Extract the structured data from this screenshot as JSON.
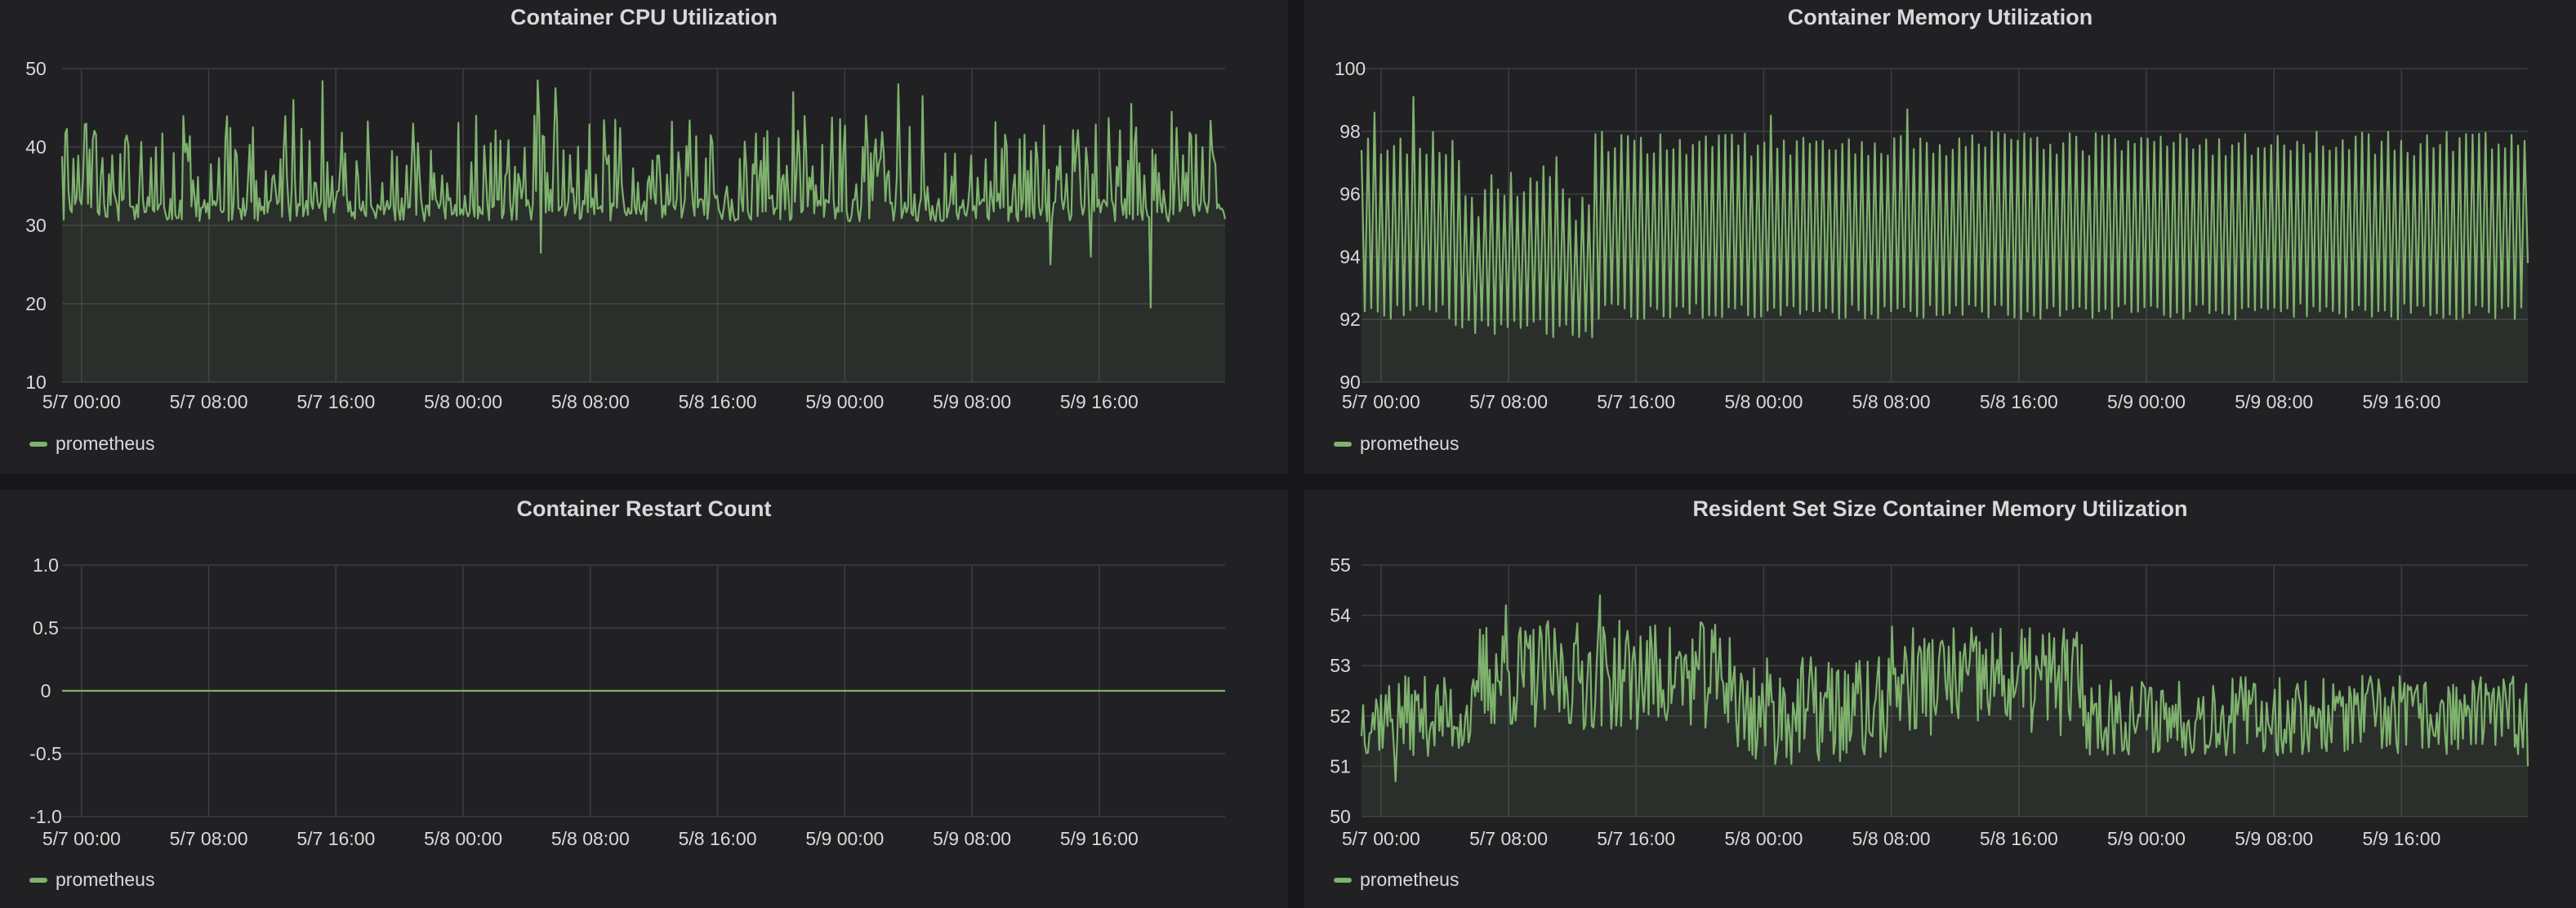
{
  "colors": {
    "background": "#161719",
    "panel": "#212124",
    "series": "#7eb26d",
    "fill": "#2e302c",
    "grid": "#3d3e41",
    "text": "#d8d9da"
  },
  "panels": [
    {
      "title": "Container CPU Utilization",
      "legend": "prometheus"
    },
    {
      "title": "Container Memory Utilization",
      "legend": "prometheus"
    },
    {
      "title": "Container Restart Count",
      "legend": "prometheus"
    },
    {
      "title": "Resident Set Size Container Memory Utilization",
      "legend": "prometheus"
    }
  ],
  "chart_data": [
    {
      "type": "area",
      "title": "Container CPU Utilization",
      "ylim": [
        10,
        50
      ],
      "ytick_labels": [
        "10",
        "20",
        "30",
        "40",
        "50"
      ],
      "x_start": "5/7 00:00",
      "x_end": "5/9 24:00",
      "xtick_labels": [
        "5/7 00:00",
        "5/7 08:00",
        "5/7 16:00",
        "5/8 00:00",
        "5/8 08:00",
        "5/8 16:00",
        "5/9 00:00",
        "5/9 08:00",
        "5/9 16:00"
      ],
      "grid": true,
      "legend_position": "bottom-left",
      "series": [
        {
          "name": "prometheus",
          "baseline": 31,
          "typical_peak_range": [
            38,
            44
          ],
          "max": 48.5,
          "min": 19.5,
          "points_estimated": [
            [
              "5/7 00:00",
              38
            ],
            [
              "5/7 01:00",
              41
            ],
            [
              "5/7 02:00",
              36
            ],
            [
              "5/7 03:00",
              32
            ],
            [
              "5/7 04:00",
              40
            ],
            [
              "5/7 05:00",
              34
            ],
            [
              "5/7 08:00",
              36
            ],
            [
              "5/7 11:00",
              46
            ],
            [
              "5/7 13:00",
              44
            ],
            [
              "5/7 15:00",
              48.5
            ],
            [
              "5/7 17:00",
              33
            ],
            [
              "5/7 20:00",
              43
            ],
            [
              "5/8 00:00",
              44
            ],
            [
              "5/8 03:00",
              41
            ],
            [
              "5/8 05:00",
              48.5
            ],
            [
              "5/8 06:00",
              27
            ],
            [
              "5/8 08:00",
              42
            ],
            [
              "5/8 12:00",
              44
            ],
            [
              "5/8 16:00",
              43
            ],
            [
              "5/8 20:00",
              46
            ],
            [
              "5/9 00:00",
              45
            ],
            [
              "5/9 04:00",
              48
            ],
            [
              "5/9 08:00",
              43
            ],
            [
              "5/9 12:00",
              45
            ],
            [
              "5/9 14:00",
              25
            ],
            [
              "5/9 16:00",
              26
            ],
            [
              "5/9 17:00",
              19.5
            ],
            [
              "5/9 20:00",
              44
            ],
            [
              "5/9 22:00",
              42
            ],
            [
              "5/9 24:00",
              31
            ]
          ]
        }
      ]
    },
    {
      "type": "area",
      "title": "Container Memory Utilization",
      "ylim": [
        90,
        100
      ],
      "ytick_labels": [
        "90",
        "92",
        "94",
        "96",
        "98",
        "100"
      ],
      "x_start": "5/7 00:00",
      "x_end": "5/9 24:00",
      "xtick_labels": [
        "5/7 00:00",
        "5/7 08:00",
        "5/7 16:00",
        "5/8 00:00",
        "5/8 08:00",
        "5/8 16:00",
        "5/9 00:00",
        "5/9 08:00",
        "5/9 16:00"
      ],
      "grid": true,
      "legend_position": "bottom-left",
      "series": [
        {
          "name": "prometheus",
          "oscillation_range": [
            92,
            97.8
          ],
          "max": 99.1,
          "min": 91.4,
          "points_estimated": [
            [
              "5/7 00:00",
              96.5
            ],
            [
              "5/7 02:00",
              98.6
            ],
            [
              "5/7 06:00",
              99.1
            ],
            [
              "5/7 07:00",
              91.4
            ],
            [
              "5/7 08:00",
              91.5
            ],
            [
              "5/7 16:00",
              97.8
            ],
            [
              "5/8 00:00",
              97.3
            ],
            [
              "5/8 06:00",
              98.5
            ],
            [
              "5/8 08:00",
              98.7
            ],
            [
              "5/8 14:00",
              98.8
            ],
            [
              "5/9 00:00",
              97.7
            ],
            [
              "5/9 08:00",
              97.8
            ],
            [
              "5/9 12:00",
              98.1
            ],
            [
              "5/9 24:00",
              93.8
            ]
          ]
        }
      ]
    },
    {
      "type": "area",
      "title": "Container Restart Count",
      "ylim": [
        -1.0,
        1.0
      ],
      "ytick_labels": [
        "1.0",
        "0.5",
        "0",
        "-0.5",
        "-1.0"
      ],
      "x_start": "5/7 00:00",
      "x_end": "5/9 24:00",
      "xtick_labels": [
        "5/7 00:00",
        "5/7 08:00",
        "5/7 16:00",
        "5/8 00:00",
        "5/8 08:00",
        "5/8 16:00",
        "5/9 00:00",
        "5/9 08:00",
        "5/9 16:00"
      ],
      "grid": true,
      "legend_position": "bottom-left",
      "series": [
        {
          "name": "prometheus",
          "points": [
            [
              "5/7 00:00",
              0
            ],
            [
              "5/9 24:00",
              0
            ]
          ]
        }
      ]
    },
    {
      "type": "area",
      "title": "Resident Set Size Container Memory Utilization",
      "ylim": [
        50,
        55
      ],
      "ytick_labels": [
        "50",
        "51",
        "52",
        "53",
        "54",
        "55"
      ],
      "x_start": "5/7 00:00",
      "x_end": "5/9 24:00",
      "xtick_labels": [
        "5/7 00:00",
        "5/7 08:00",
        "5/7 16:00",
        "5/8 00:00",
        "5/8 08:00",
        "5/8 16:00",
        "5/9 00:00",
        "5/9 08:00",
        "5/9 16:00"
      ],
      "grid": true,
      "legend_position": "bottom-left",
      "series": [
        {
          "name": "prometheus",
          "max": 54.4,
          "min": 50.6,
          "points_estimated": [
            [
              "5/7 00:00",
              51.5
            ],
            [
              "5/7 02:00",
              51.0
            ],
            [
              "5/7 03:00",
              50.6
            ],
            [
              "5/7 05:00",
              52.0
            ],
            [
              "5/7 06:00",
              52.5
            ],
            [
              "5/7 08:00",
              53.2
            ],
            [
              "5/7 10:00",
              54.2
            ],
            [
              "5/7 14:00",
              53.5
            ],
            [
              "5/7 16:00",
              54.0
            ],
            [
              "5/7 18:00",
              54.4
            ],
            [
              "5/8 00:00",
              52.5
            ],
            [
              "5/8 04:00",
              52.3
            ],
            [
              "5/8 08:00",
              53.2
            ],
            [
              "5/8 10:00",
              54.2
            ],
            [
              "5/8 14:00",
              53.6
            ],
            [
              "5/8 16:00",
              54.0
            ],
            [
              "5/8 20:00",
              52.6
            ],
            [
              "5/9 00:00",
              52.0
            ],
            [
              "5/9 04:00",
              52.3
            ],
            [
              "5/9 08:00",
              51.9
            ],
            [
              "5/9 12:00",
              52.4
            ],
            [
              "5/9 16:00",
              52.6
            ],
            [
              "5/9 20:00",
              52.4
            ],
            [
              "5/9 24:00",
              51.0
            ]
          ]
        }
      ]
    }
  ]
}
